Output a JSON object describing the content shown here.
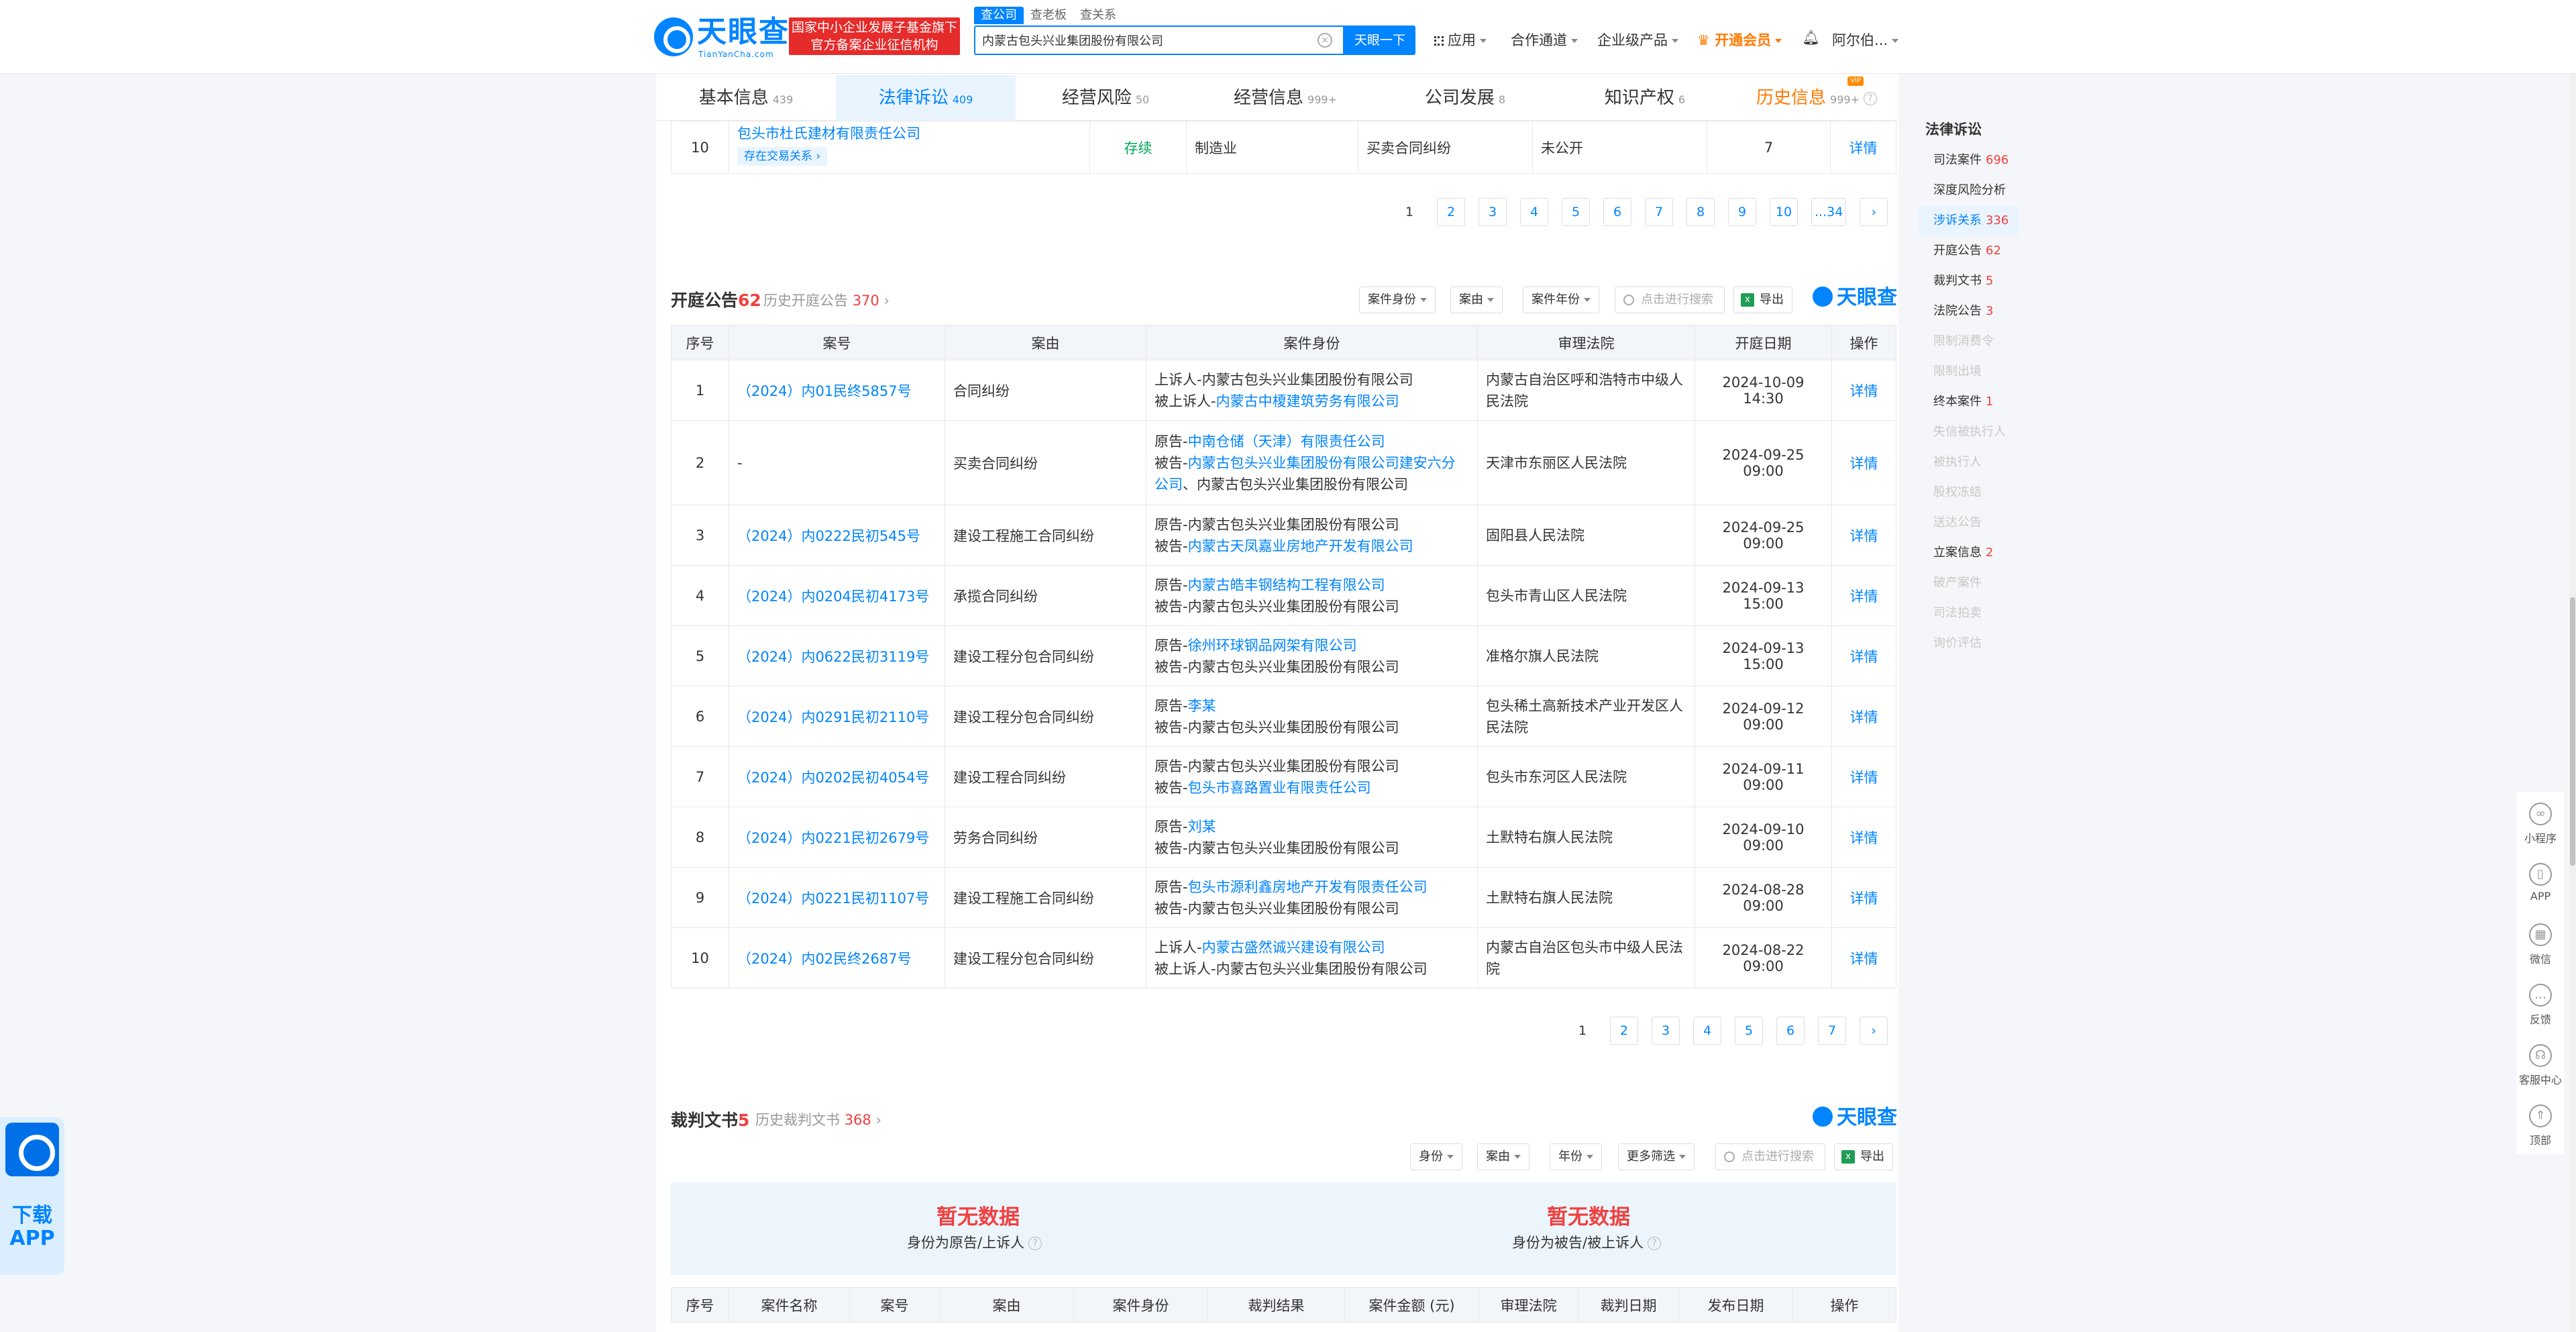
{
  "header": {
    "logo_main": "天眼查",
    "logo_sub": "TianYanCha.com",
    "gov_badge_line1": "国家中小企业发展子基金旗下",
    "gov_badge_line2": "官方备案企业征信机构",
    "search_tabs": [
      "查公司",
      "查老板",
      "查关系"
    ],
    "search_value": "内蒙古包头兴业集团股份有限公司",
    "search_button": "天眼一下",
    "nav": [
      "应用",
      "合作通道",
      "企业级产品",
      "开通会员",
      "阿尔伯..."
    ]
  },
  "tabs": [
    {
      "label": "基本信息",
      "count": "439"
    },
    {
      "label": "法律诉讼",
      "count": "409"
    },
    {
      "label": "经营风险",
      "count": "50"
    },
    {
      "label": "经营信息",
      "count": "999+"
    },
    {
      "label": "公司发展",
      "count": "8"
    },
    {
      "label": "知识产权",
      "count": "6"
    },
    {
      "label": "历史信息",
      "count": "999+",
      "badge": "VIP"
    }
  ],
  "prev_row": {
    "index": "10",
    "company": "包头市杜氏建材有限责任公司",
    "tag": "存在交易关系",
    "status": "存续",
    "industry": "制造业",
    "cause": "买卖合同纠纷",
    "amount": "未公开",
    "count": "7",
    "detail": "详情"
  },
  "pager1": [
    "1",
    "2",
    "3",
    "4",
    "5",
    "6",
    "7",
    "8",
    "9",
    "10",
    "...34"
  ],
  "hearing": {
    "title": "开庭公告",
    "count": "62",
    "history_label": "历史开庭公告",
    "history_count": "370",
    "filters": [
      "案件身份",
      "案由",
      "案件年份"
    ],
    "search_placeholder": "点击进行搜索",
    "export": "导出",
    "brand": "天眼查",
    "columns": [
      "序号",
      "案号",
      "案由",
      "案件身份",
      "审理法院",
      "开庭日期",
      "操作"
    ],
    "rows": [
      {
        "idx": "1",
        "case_no": "（2024）内01民终5857号",
        "cause": "合同纠纷",
        "l1p": "上诉人-",
        "l1n": "内蒙古包头兴业集团股份有限公司",
        "l2p": "被上诉人-",
        "l2n": "内蒙古中榎建筑劳务有限公司",
        "l3": "",
        "court": "内蒙古自治区呼和浩特市中级人民法院",
        "date": "2024-10-09 14:30"
      },
      {
        "idx": "2",
        "case_no": "-",
        "cause": "买卖合同纠纷",
        "l1p": "原告-",
        "l1n": "中南仓储（天津）有限责任公司",
        "l2p": "被告-",
        "l2n": "内蒙古包头兴业集团股份有限公司建安六分公司",
        "l3": "、内蒙古包头兴业集团股份有限公司",
        "court": "天津市东丽区人民法院",
        "date": "2024-09-25 09:00"
      },
      {
        "idx": "3",
        "case_no": "（2024）内0222民初545号",
        "cause": "建设工程施工合同纠纷",
        "l1p": "原告-",
        "l1n": "内蒙古包头兴业集团股份有限公司",
        "l2p": "被告-",
        "l2n": "内蒙古天凤嘉业房地产开发有限公司",
        "l3": "",
        "court": "固阳县人民法院",
        "date": "2024-09-25 09:00"
      },
      {
        "idx": "4",
        "case_no": "（2024）内0204民初4173号",
        "cause": "承揽合同纠纷",
        "l1p": "原告-",
        "l1n": "内蒙古皓丰钢结构工程有限公司",
        "l2p": "被告-",
        "l2n": "内蒙古包头兴业集团股份有限公司",
        "l3": "",
        "court": "包头市青山区人民法院",
        "date": "2024-09-13 15:00"
      },
      {
        "idx": "5",
        "case_no": "（2024）内0622民初3119号",
        "cause": "建设工程分包合同纠纷",
        "l1p": "原告-",
        "l1n": "徐州环球钢品网架有限公司",
        "l2p": "被告-",
        "l2n": "内蒙古包头兴业集团股份有限公司",
        "l3": "",
        "court": "准格尔旗人民法院",
        "date": "2024-09-13 15:00"
      },
      {
        "idx": "6",
        "case_no": "（2024）内0291民初2110号",
        "cause": "建设工程分包合同纠纷",
        "l1p": "原告-",
        "l1n": "李某",
        "l2p": "被告-",
        "l2n": "内蒙古包头兴业集团股份有限公司",
        "l3": "",
        "court": "包头稀土高新技术产业开发区人民法院",
        "date": "2024-09-12 09:00"
      },
      {
        "idx": "7",
        "case_no": "（2024）内0202民初4054号",
        "cause": "建设工程合同纠纷",
        "l1p": "原告-",
        "l1n": "内蒙古包头兴业集团股份有限公司",
        "l2p": "被告-",
        "l2n": "包头市喜路置业有限责任公司",
        "l3": "",
        "court": "包头市东河区人民法院",
        "date": "2024-09-11 09:00"
      },
      {
        "idx": "8",
        "case_no": "（2024）内0221民初2679号",
        "cause": "劳务合同纠纷",
        "l1p": "原告-",
        "l1n": "刘某",
        "l2p": "被告-",
        "l2n": "内蒙古包头兴业集团股份有限公司",
        "l3": "",
        "court": "土默特右旗人民法院",
        "date": "2024-09-10 09:00"
      },
      {
        "idx": "9",
        "case_no": "（2024）内0221民初1107号",
        "cause": "建设工程施工合同纠纷",
        "l1p": "原告-",
        "l1n": "包头市源利鑫房地产开发有限责任公司",
        "l2p": "被告-",
        "l2n": "内蒙古包头兴业集团股份有限公司",
        "l3": "",
        "court": "土默特右旗人民法院",
        "date": "2024-08-28 09:00"
      },
      {
        "idx": "10",
        "case_no": "（2024）内02民终2687号",
        "cause": "建设工程分包合同纠纷",
        "l1p": "上诉人-",
        "l1n": "内蒙古盛然诚兴建设有限公司",
        "l2p": "被上诉人-",
        "l2n": "内蒙古包头兴业集团股份有限公司",
        "l3": "",
        "court": "内蒙古自治区包头市中级人民法院",
        "date": "2024-08-22 09:00"
      }
    ],
    "detail": "详情"
  },
  "pager2": [
    "1",
    "2",
    "3",
    "4",
    "5",
    "6",
    "7"
  ],
  "judgment": {
    "title": "裁判文书",
    "count": "5",
    "history_label": "历史裁判文书",
    "history_count": "368",
    "filters": [
      "身份",
      "案由",
      "年份",
      "更多筛选"
    ],
    "search_placeholder": "点击进行搜索",
    "export": "导出",
    "brand": "天眼查",
    "empty_left_title": "暂无数据",
    "empty_left_sub": "身份为原告/上诉人",
    "empty_right_title": "暂无数据",
    "empty_right_sub": "身份为被告/被上诉人",
    "columns": [
      "序号",
      "案件名称",
      "案号",
      "案由",
      "案件身份",
      "裁判结果",
      "案件金额 (元)",
      "审理法院",
      "裁判日期",
      "发布日期",
      "操作"
    ]
  },
  "sidebar": {
    "title": "法律诉讼",
    "items": [
      {
        "label": "司法案件",
        "count": "696",
        "state": "normal"
      },
      {
        "label": "深度风险分析",
        "count": "",
        "state": "normal"
      },
      {
        "label": "涉诉关系",
        "count": "336",
        "state": "active"
      },
      {
        "label": "开庭公告",
        "count": "62",
        "state": "normal"
      },
      {
        "label": "裁判文书",
        "count": "5",
        "state": "normal"
      },
      {
        "label": "法院公告",
        "count": "3",
        "state": "normal"
      },
      {
        "label": "限制消费令",
        "count": "",
        "state": "disabled"
      },
      {
        "label": "限制出境",
        "count": "",
        "state": "disabled"
      },
      {
        "label": "终本案件",
        "count": "1",
        "state": "normal"
      },
      {
        "label": "失信被执行人",
        "count": "",
        "state": "disabled"
      },
      {
        "label": "被执行人",
        "count": "",
        "state": "disabled"
      },
      {
        "label": "股权冻结",
        "count": "",
        "state": "disabled"
      },
      {
        "label": "送达公告",
        "count": "",
        "state": "disabled"
      },
      {
        "label": "立案信息",
        "count": "2",
        "state": "normal"
      },
      {
        "label": "破产案件",
        "count": "",
        "state": "disabled"
      },
      {
        "label": "司法拍卖",
        "count": "",
        "state": "disabled"
      },
      {
        "label": "询价评估",
        "count": "",
        "state": "disabled"
      }
    ]
  },
  "tools": [
    {
      "label": "小程序",
      "icon": "mini-program-icon"
    },
    {
      "label": "APP",
      "icon": "phone-icon"
    },
    {
      "label": "微信",
      "icon": "qr-code-icon"
    },
    {
      "label": "反馈",
      "icon": "feedback-icon"
    },
    {
      "label": "客服中心",
      "icon": "headset-icon"
    },
    {
      "label": "顶部",
      "icon": "rocket-icon"
    }
  ],
  "download_app": "下载APP",
  "colors": {
    "brand_blue": "#0084ff",
    "alert_red": "#f04040",
    "status_green": "#00a85a",
    "vip_orange": "#ff7a00"
  }
}
